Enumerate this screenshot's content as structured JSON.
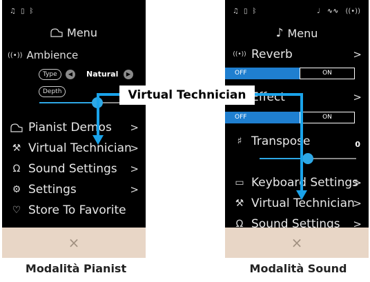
{
  "left": {
    "title": "Menu",
    "ambience": {
      "label": "Ambience",
      "type_label": "Type",
      "type_value": "Natural",
      "depth_label": "Depth",
      "depth_level": 0.6
    },
    "items": [
      {
        "label": "Pianist Demos",
        "icon": "piano-icon"
      },
      {
        "label": "Virtual Technician",
        "icon": "technician-icon"
      },
      {
        "label": "Sound Settings",
        "icon": "headphones-icon"
      },
      {
        "label": "Settings",
        "icon": "gear-icon"
      },
      {
        "label": "Store To Favorite",
        "icon": "heart-icon"
      }
    ],
    "chev": ">",
    "close": "×",
    "caption": "Modalità Pianist"
  },
  "right": {
    "title": "Menu",
    "reverb": {
      "label": "Reverb",
      "off": "OFF",
      "on": "ON"
    },
    "effect": {
      "label": "Effect",
      "off": "OFF",
      "on": "ON"
    },
    "transpose": {
      "label": "Transpose",
      "value": "0",
      "level": 0.5
    },
    "items": [
      {
        "label": "Keyboard Settings",
        "icon": "keyboard-icon"
      },
      {
        "label": "Virtual Technician",
        "icon": "technician-icon"
      },
      {
        "label": "Sound Settings",
        "icon": "headphones-icon"
      }
    ],
    "chev": ">",
    "close": "×",
    "caption": "Modalità Sound"
  },
  "overlay_label": "Virtual Technician",
  "accent": "#2ea8e6"
}
